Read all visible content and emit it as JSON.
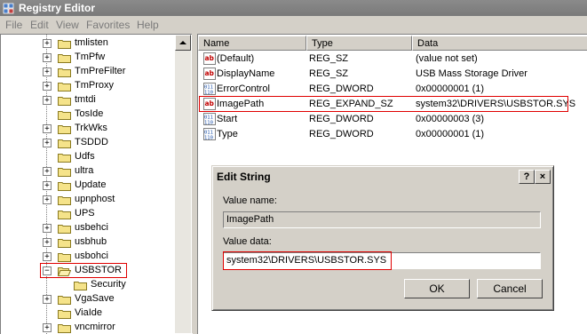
{
  "window": {
    "title": "Registry Editor"
  },
  "menu": [
    "File",
    "Edit",
    "View",
    "Favorites",
    "Help"
  ],
  "tree": {
    "items": [
      {
        "label": "tmlisten",
        "expandable": true
      },
      {
        "label": "TmPfw",
        "expandable": true
      },
      {
        "label": "TmPreFilter",
        "expandable": true
      },
      {
        "label": "TmProxy",
        "expandable": true
      },
      {
        "label": "tmtdi",
        "expandable": true
      },
      {
        "label": "TosIde",
        "expandable": false
      },
      {
        "label": "TrkWks",
        "expandable": true
      },
      {
        "label": "TSDDD",
        "expandable": true
      },
      {
        "label": "Udfs",
        "expandable": false
      },
      {
        "label": "ultra",
        "expandable": true
      },
      {
        "label": "Update",
        "expandable": true
      },
      {
        "label": "upnphost",
        "expandable": true
      },
      {
        "label": "UPS",
        "expandable": false
      },
      {
        "label": "usbehci",
        "expandable": true
      },
      {
        "label": "usbhub",
        "expandable": true
      },
      {
        "label": "usbohci",
        "expandable": true
      },
      {
        "label": "USBSTOR",
        "expandable": true,
        "expanded": true,
        "selected": true
      },
      {
        "label": "Security",
        "expandable": false,
        "child": true
      },
      {
        "label": "VgaSave",
        "expandable": true
      },
      {
        "label": "ViaIde",
        "expandable": false
      },
      {
        "label": "vncmirror",
        "expandable": true
      }
    ]
  },
  "list": {
    "headers": {
      "name": "Name",
      "type": "Type",
      "data": "Data"
    },
    "rows": [
      {
        "name": "(Default)",
        "type": "REG_SZ",
        "data": "(value not set)",
        "icon": "string-value-icon"
      },
      {
        "name": "DisplayName",
        "type": "REG_SZ",
        "data": "USB Mass Storage Driver",
        "icon": "string-value-icon"
      },
      {
        "name": "ErrorControl",
        "type": "REG_DWORD",
        "data": "0x00000001 (1)",
        "icon": "binary-value-icon"
      },
      {
        "name": "ImagePath",
        "type": "REG_EXPAND_SZ",
        "data": "system32\\DRIVERS\\USBSTOR.SYS",
        "icon": "string-value-icon"
      },
      {
        "name": "Start",
        "type": "REG_DWORD",
        "data": "0x00000003 (3)",
        "icon": "binary-value-icon"
      },
      {
        "name": "Type",
        "type": "REG_DWORD",
        "data": "0x00000001 (1)",
        "icon": "binary-value-icon"
      }
    ]
  },
  "dialog": {
    "title": "Edit String",
    "help_btn": "?",
    "close_btn": "×",
    "value_name_label": "Value name:",
    "value_name": "ImagePath",
    "value_data_label": "Value data:",
    "value_data": "system32\\DRIVERS\\USBSTOR.SYS",
    "ok": "OK",
    "cancel": "Cancel"
  },
  "colors": {
    "highlight": "#e00000",
    "folder": "#f5e38a",
    "titlebar": "#7a7a7a",
    "chrome": "#d4d0c8"
  }
}
